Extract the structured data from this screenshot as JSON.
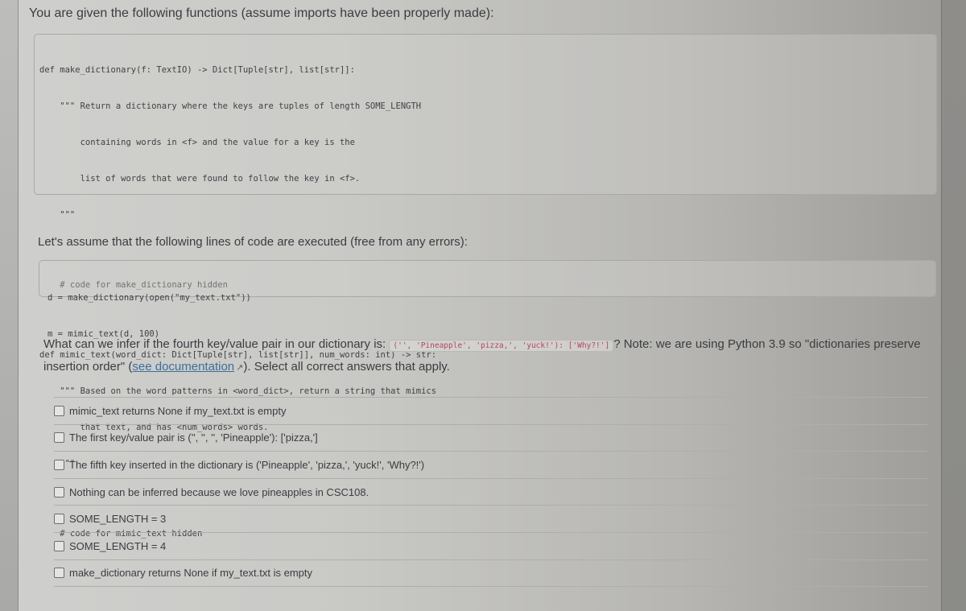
{
  "question": {
    "intro": "You are given the following functions (assume imports have been properly made):",
    "code_block_1": [
      "def make_dictionary(f: TextIO) -> Dict[Tuple[str], list[str]]:",
      "    \"\"\" Return a dictionary where the keys are tuples of length SOME_LENGTH",
      "        containing words in <f> and the value for a key is the",
      "        list of words that were found to follow the key in <f>.",
      "    \"\"\"",
      "    # code for make_dictionary hidden",
      "",
      "def mimic_text(word_dict: Dict[Tuple[str], list[str]], num_words: int) -> str:",
      "    \"\"\" Based on the word patterns in <word_dict>, return a string that mimics",
      "        that text, and has <num_words> words.",
      "    \"\"\"",
      "    # code for mimic_text hidden"
    ],
    "assume_text": "Let's assume that the following lines of code are executed (free from any errors):",
    "code_block_2": [
      "d = make_dictionary(open(\"my_text.txt\"))",
      "m = mimic_text(d, 100)"
    ],
    "prompt_part1": "What can we infer if the fourth key/value pair in our dictionary is: ",
    "prompt_inline_code": "('', 'Pineapple', 'pizza,', 'yuck!'): ['Why?!']",
    "prompt_part2": "? Note: we are using Python 3.9 so \"dictionaries preserve insertion order\" (",
    "link_text": "see documentation",
    "link_icon": "external-link-icon",
    "prompt_part3": "). Select all correct answers that apply.",
    "answers": [
      {
        "label": "mimic_text returns None if my_text.txt is empty",
        "checked": false
      },
      {
        "label": "The first key/value pair is ('', '', '', 'Pineapple'): ['pizza,']",
        "checked": false
      },
      {
        "label": "The fifth key inserted in the dictionary is ('Pineapple', 'pizza,', 'yuck!', 'Why?!')",
        "checked": false
      },
      {
        "label": "Nothing can be inferred because we love pineapples in CSC108.",
        "checked": false
      },
      {
        "label": "SOME_LENGTH = 3",
        "checked": false
      },
      {
        "label": "SOME_LENGTH = 4",
        "checked": false
      },
      {
        "label": "make_dictionary returns None if my_text.txt is empty",
        "checked": false
      }
    ]
  },
  "colors": {
    "inline_code_text": "#b5475a",
    "link": "#3d6f9c",
    "body_text": "#3a3d40"
  }
}
